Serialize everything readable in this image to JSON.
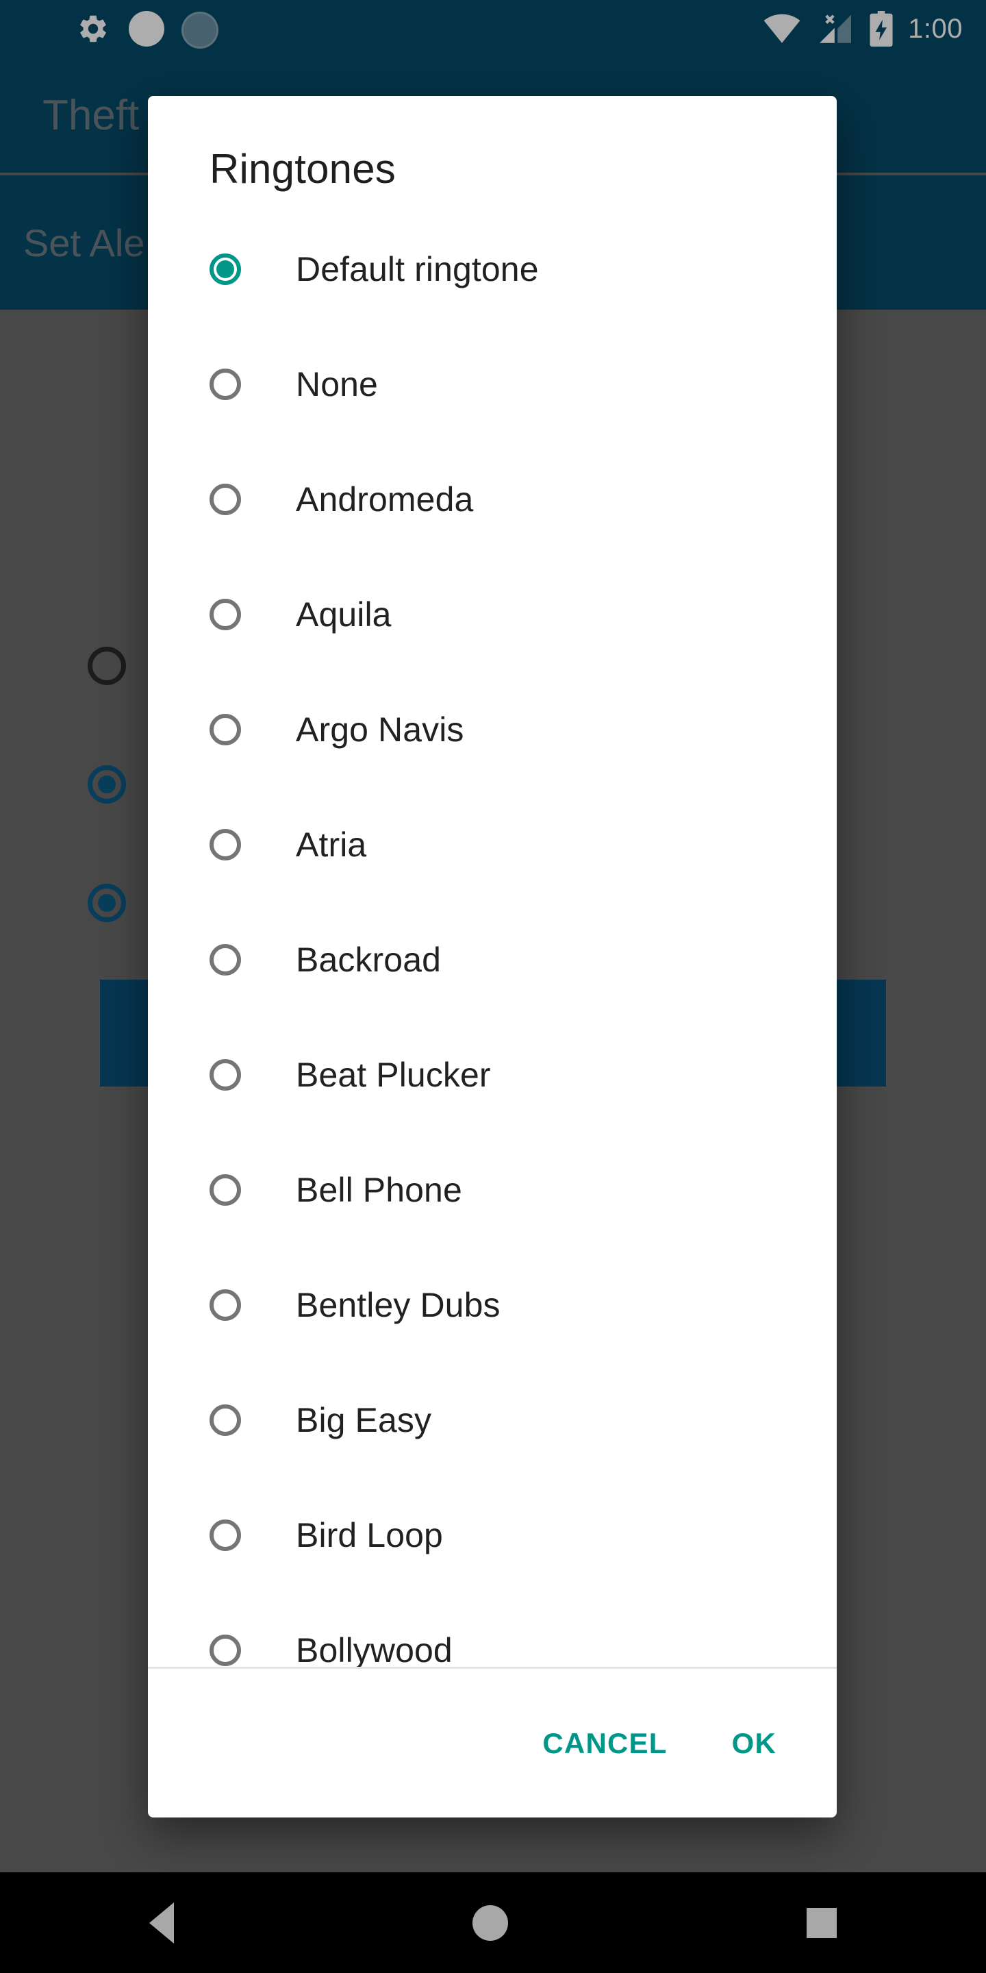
{
  "status_bar": {
    "time": "1:00",
    "left_icons": [
      "gear-icon",
      "white-circle-icon",
      "loading-spinner-icon"
    ],
    "right_icons": [
      "wifi-icon",
      "cellular-no-sim-icon",
      "battery-charging-icon"
    ]
  },
  "background_app": {
    "app_bar_title": "Theft",
    "sub_bar_title": "Set Ale",
    "radio_states": [
      "unchecked",
      "checked",
      "checked"
    ],
    "header_color": "#064A68",
    "scrim_color": "#6b6b6b"
  },
  "dialog": {
    "title": "Ringtones",
    "accent_color": "#009688",
    "items": [
      {
        "label": "Default ringtone",
        "selected": true
      },
      {
        "label": "None",
        "selected": false
      },
      {
        "label": "Andromeda",
        "selected": false
      },
      {
        "label": "Aquila",
        "selected": false
      },
      {
        "label": "Argo Navis",
        "selected": false
      },
      {
        "label": "Atria",
        "selected": false
      },
      {
        "label": "Backroad",
        "selected": false
      },
      {
        "label": "Beat Plucker",
        "selected": false
      },
      {
        "label": "Bell Phone",
        "selected": false
      },
      {
        "label": "Bentley Dubs",
        "selected": false
      },
      {
        "label": "Big Easy",
        "selected": false
      },
      {
        "label": "Bird Loop",
        "selected": false
      },
      {
        "label": "Bollywood",
        "selected": false
      }
    ],
    "cancel_label": "CANCEL",
    "ok_label": "OK"
  },
  "navigation_bar": {
    "back_label": "Back",
    "home_label": "Home",
    "recents_label": "Recents"
  }
}
